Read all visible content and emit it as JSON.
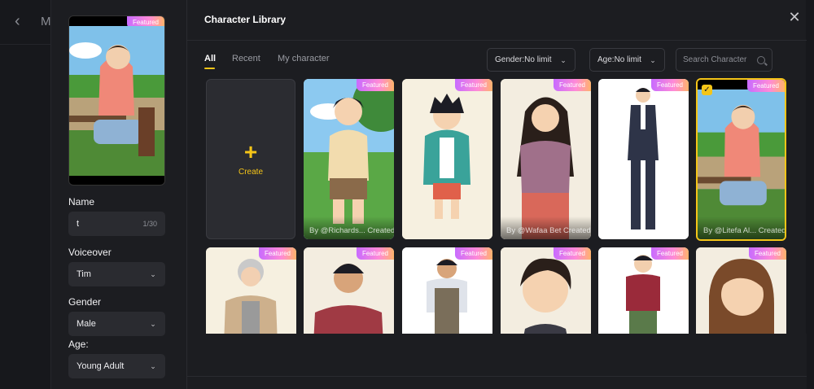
{
  "background": {
    "app_title_partial": "Ma"
  },
  "modal": {
    "title": "Character Library",
    "tabs": [
      {
        "label": "All",
        "active": true
      },
      {
        "label": "Recent",
        "active": false
      },
      {
        "label": "My character",
        "active": false
      }
    ],
    "filters": {
      "gender": "Gender:No limit",
      "age": "Age:No limit",
      "search_placeholder": "Search Character"
    },
    "create_label": "Create",
    "badge_label": "Featured",
    "cards": [
      {
        "id": "c1",
        "byline": "By @Richards... Created"
      },
      {
        "id": "c2",
        "byline": ""
      },
      {
        "id": "c3",
        "byline": "By @Wafaa Bet Created"
      },
      {
        "id": "c4",
        "byline": ""
      },
      {
        "id": "c5",
        "byline": "By @Litefa Al... Created",
        "selected": true
      },
      {
        "id": "c6",
        "byline": ""
      },
      {
        "id": "c7",
        "byline": ""
      },
      {
        "id": "c8",
        "byline": ""
      },
      {
        "id": "c9",
        "byline": ""
      },
      {
        "id": "c10",
        "byline": ""
      },
      {
        "id": "c11",
        "byline": ""
      }
    ]
  },
  "left_panel": {
    "preview_badge": "Featured",
    "name_label": "Name",
    "name_value": "t",
    "name_count": "1/30",
    "voiceover_label": "Voiceover",
    "voiceover_value": "Tim",
    "gender_label": "Gender",
    "gender_value": "Male",
    "age_label": "Age:",
    "age_value": "Young Adult"
  },
  "colors": {
    "accent": "#f5c518",
    "panel": "#1c1d21",
    "field": "#2a2b30"
  }
}
